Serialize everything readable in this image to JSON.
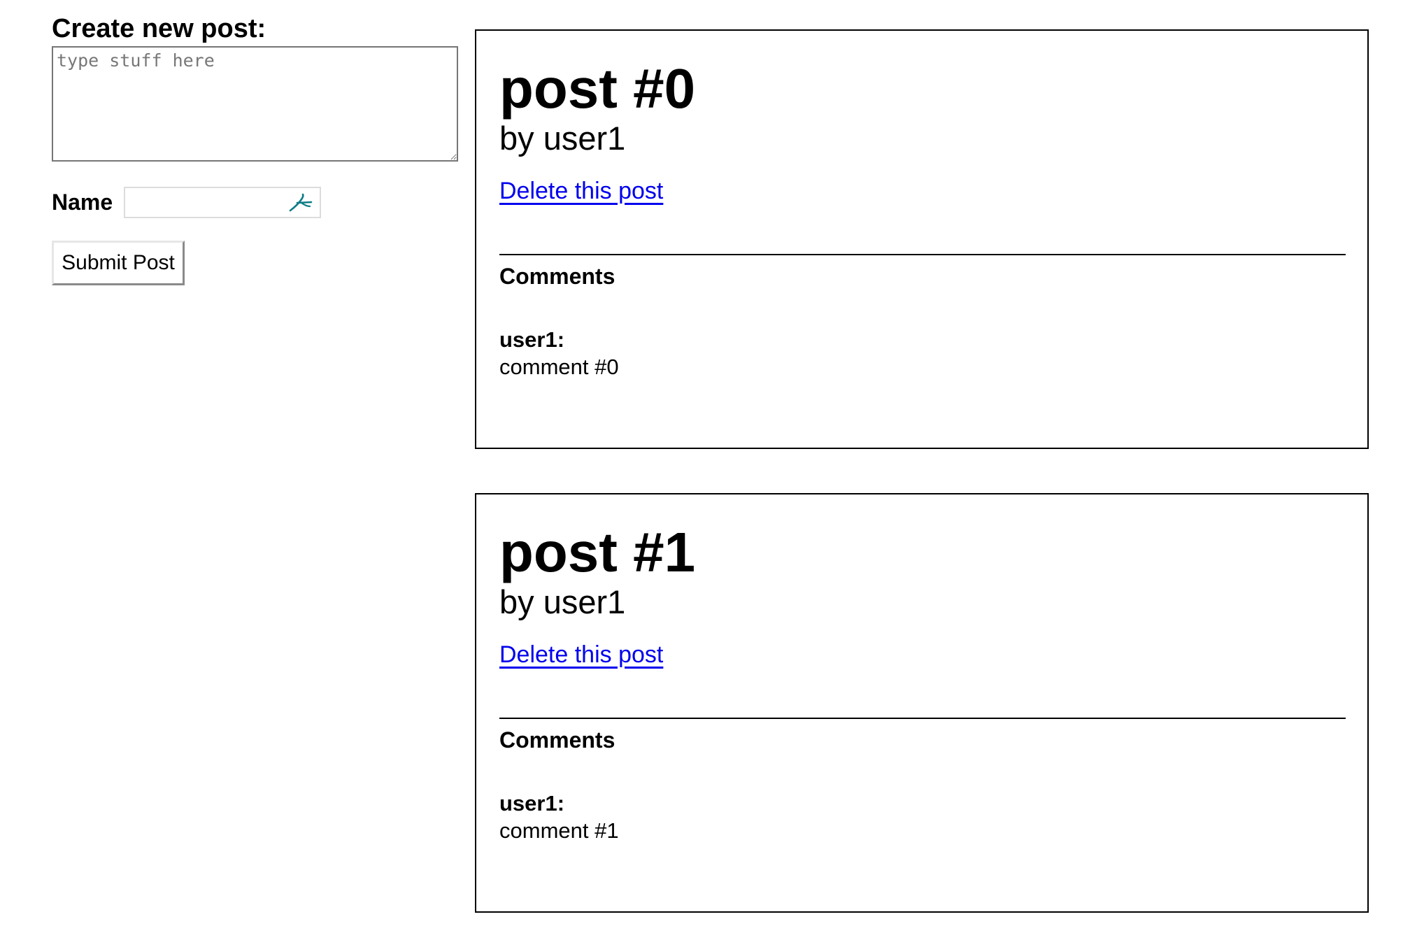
{
  "form": {
    "title": "Create new post:",
    "textarea_placeholder": "type stuff here",
    "textarea_value": "",
    "name_label": "Name",
    "name_value": "",
    "submit_label": "Submit Post"
  },
  "posts": [
    {
      "title": "post #0",
      "author": "by user1",
      "delete_label": "Delete this post",
      "comments_heading": "Comments",
      "comments": [
        {
          "user": "user1:",
          "text": "comment #0"
        }
      ]
    },
    {
      "title": "post #1",
      "author": "by user1",
      "delete_label": "Delete this post",
      "comments_heading": "Comments",
      "comments": [
        {
          "user": "user1:",
          "text": "comment #1"
        }
      ]
    }
  ],
  "colors": {
    "link": "#0000ee",
    "border": "#000000",
    "autofill_icon": "#0e7c86"
  },
  "icons": {
    "autofill": "password-manager-autofill-icon"
  }
}
